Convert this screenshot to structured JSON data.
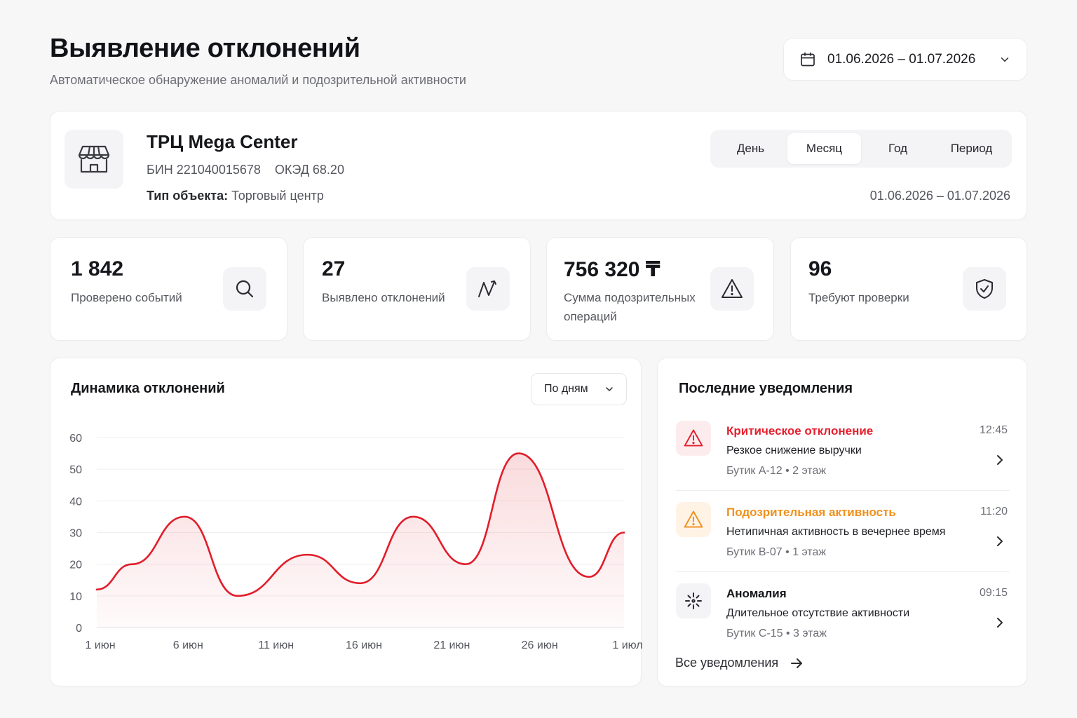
{
  "header": {
    "title": "Выявление отклонений",
    "subtitle": "Автоматическое обнаружение аномалий и подозрительной активности",
    "date_range": "01.06.2026 – 01.07.2026"
  },
  "object": {
    "name": "ТРЦ Mega Center",
    "bin": "БИН 221040015678",
    "oked": "ОКЭД 68.20",
    "type_label": "Тип объекта:",
    "type_value": "Торговый центр",
    "periods": [
      "День",
      "Месяц",
      "Год",
      "Период"
    ],
    "active_period": "Месяц",
    "range": "01.06.2026 – 01.07.2026"
  },
  "kpis": [
    {
      "value": "1 842",
      "label": "Проверено событий",
      "icon": "search-icon"
    },
    {
      "value": "27",
      "label": "Выявлено отклонений",
      "icon": "trend-icon"
    },
    {
      "value": "756 320 ₸",
      "label": "Сумма подозрительных операций",
      "icon": "warning-icon"
    },
    {
      "value": "96",
      "label": "Требуют проверки",
      "icon": "shield-check-icon"
    }
  ],
  "chart": {
    "title": "Динамика отклонений",
    "select_value": "По дням"
  },
  "chart_data": {
    "type": "line",
    "x": [
      "1 июн",
      "3 июн",
      "6 июн",
      "9 июн",
      "13 июн",
      "16 июн",
      "19 июн",
      "22 июн",
      "25 июн",
      "29 июн",
      "1 июл"
    ],
    "x_index": [
      0,
      2,
      5,
      8,
      12,
      15,
      18,
      21,
      24,
      28,
      30
    ],
    "values": [
      12,
      20,
      35,
      10,
      23,
      14,
      35,
      20,
      55,
      16,
      30
    ],
    "tick_labels_x": [
      "1 июн",
      "6 июн",
      "11 июн",
      "16 июн",
      "21 июн",
      "26 июн",
      "1 июл"
    ],
    "tick_index_x": [
      0,
      5,
      10,
      15,
      20,
      25,
      30
    ],
    "yticks": [
      0,
      10,
      20,
      30,
      40,
      50,
      60
    ],
    "ylim": [
      0,
      60
    ],
    "color": "#e11d2a",
    "grid": true
  },
  "notifications": {
    "title": "Последние уведомления",
    "items": [
      {
        "title": "Критическое отклонение",
        "desc": "Резкое снижение выручки",
        "meta": "Бутик A-12  •  2 этаж",
        "time": "12:45",
        "color": "#e5202e",
        "bg": "#fdecee",
        "icon": "warning-icon"
      },
      {
        "title": "Подозрительная активность",
        "desc": "Нетипичная активность в вечернее время",
        "meta": "Бутик B-07  •  1 этаж",
        "time": "11:20",
        "color": "#f0901b",
        "bg": "#fff3e6",
        "icon": "warning-icon"
      },
      {
        "title": "Аномалия",
        "desc": "Длительное отсутствие активности",
        "meta": "Бутик C-15  •  3 этаж",
        "time": "09:15",
        "color": "#16171b",
        "bg": "#f4f4f6",
        "icon": "sparkle-icon"
      }
    ],
    "all_link": "Все уведомления"
  }
}
